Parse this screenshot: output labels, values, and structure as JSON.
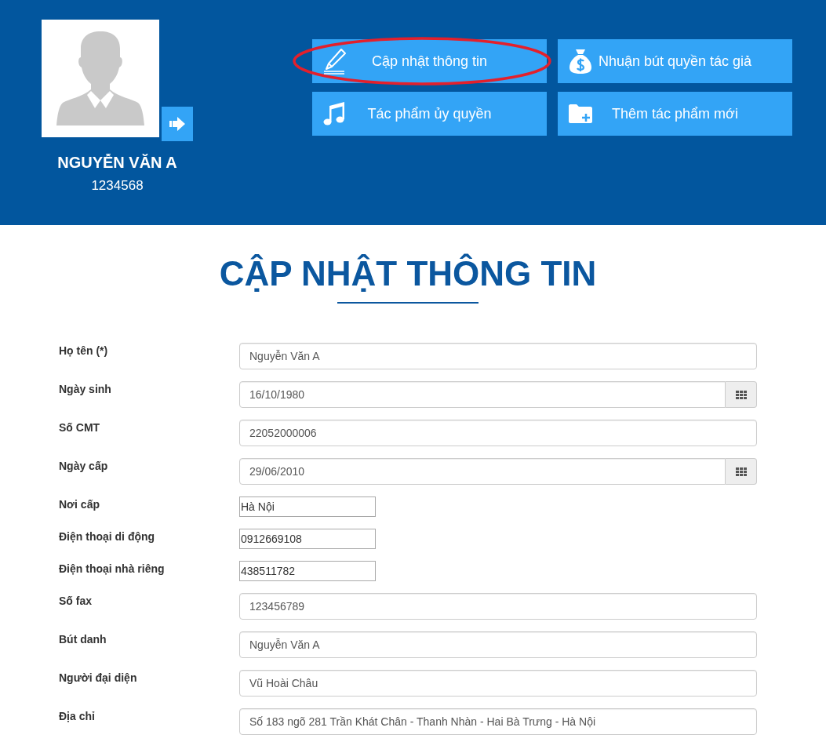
{
  "profile": {
    "name": "NGUYỄN VĂN A",
    "id": "1234568"
  },
  "tiles": [
    {
      "label": "Cập nhật thông tin",
      "circled": true
    },
    {
      "label": "Nhuận bút quyền tác giả",
      "circled": false
    },
    {
      "label": "Tác phẩm ủy quyền",
      "circled": false
    },
    {
      "label": "Thêm tác phẩm mới",
      "circled": false
    }
  ],
  "page_title": "CẬP NHẬT THÔNG TIN",
  "fields": [
    {
      "label": "Họ tên (*)",
      "value": "Nguyễn Văn A",
      "kind": "text"
    },
    {
      "label": "Ngày sinh",
      "value": "16/10/1980",
      "kind": "date"
    },
    {
      "label": "Số CMT",
      "value": "22052000006",
      "kind": "text"
    },
    {
      "label": "Ngày cấp",
      "value": "29/06/2010",
      "kind": "date"
    },
    {
      "label": "Nơi cấp",
      "value": "Hà Nội",
      "kind": "short"
    },
    {
      "label": "Điện thoại di động",
      "value": "0912669108",
      "kind": "short"
    },
    {
      "label": "Điện thoại nhà riêng",
      "value": "438511782",
      "kind": "short"
    },
    {
      "label": "Số fax",
      "value": "123456789",
      "kind": "text"
    },
    {
      "label": "Bút danh",
      "value": "Nguyễn Văn A",
      "kind": "text"
    },
    {
      "label": "Người đại diện",
      "value": "Vũ Hoài Châu",
      "kind": "text"
    },
    {
      "label": "Địa chỉ",
      "value": "Số 183 ngõ 281 Trần Khát Chân - Thanh Nhàn - Hai Bà Trưng - Hà Nội",
      "kind": "text"
    }
  ]
}
